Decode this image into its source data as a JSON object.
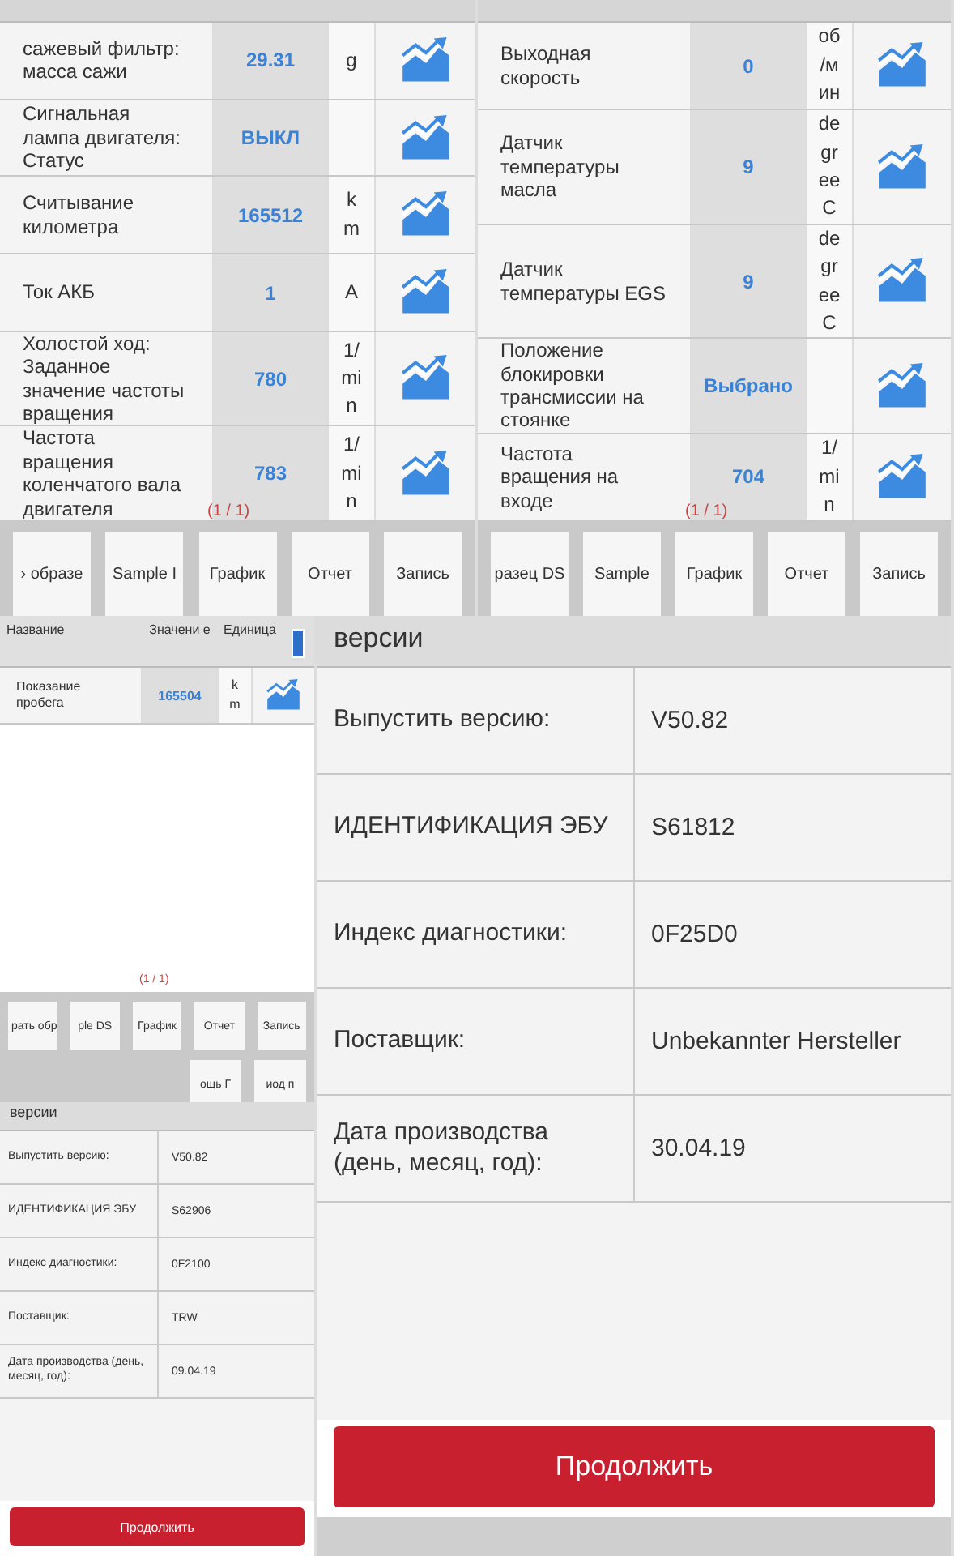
{
  "screens": [
    {
      "kind": "params",
      "page": "(1 / 1)",
      "rows": [
        {
          "name": "сажевый фильтр: масса сажи",
          "value": "29.31",
          "unit": "g"
        },
        {
          "name": "Сигнальная лампа двигателя: Статус",
          "value": "ВЫКЛ",
          "unit": ""
        },
        {
          "name": "Считывание километра",
          "value": "165512",
          "unit": "k m"
        },
        {
          "name": "Ток АКБ",
          "value": "1",
          "unit": "A"
        },
        {
          "name": "Холостой ход: Заданное значение частоты вращения",
          "value": "780",
          "unit": "1/ mi n"
        },
        {
          "name": "Частота вращения коленчатого вала двигателя",
          "value": "783",
          "unit": "1/ mi n"
        }
      ],
      "button_rows": [
        [
          "› образе",
          "Sample I",
          "График",
          "Отчет",
          "Запись"
        ]
      ]
    },
    {
      "kind": "params",
      "page": "(1 / 1)",
      "rows": [
        {
          "name": "Выходная скорость",
          "value": "0",
          "unit": "об /м ин"
        },
        {
          "name": "Датчик температуры масла",
          "value": "9",
          "unit": "de gr ee C"
        },
        {
          "name": "Датчик температуры EGS",
          "value": "9",
          "unit": "de gr ee C"
        },
        {
          "name": "Положение блокировки трансмиссии на стоянке",
          "value": "Выбрано",
          "unit": ""
        },
        {
          "name": "Частота вращения на входе",
          "value": "704",
          "unit": "1/ mi n"
        }
      ],
      "button_rows": [
        [
          "разец DS",
          "Sample",
          "График",
          "Отчет",
          "Запись"
        ]
      ]
    },
    {
      "kind": "params",
      "page": "(1 / 1)",
      "columns": [
        "Название",
        "Значени е",
        "Единица"
      ],
      "rows": [
        {
          "name": "Показание пробега",
          "value": "165504",
          "unit": "k m"
        }
      ],
      "button_rows": [
        [
          "рать обр",
          "ple DS",
          "График",
          "Отчет",
          "Запись"
        ],
        [
          "ощь Г",
          "иод п"
        ]
      ]
    },
    {
      "kind": "info",
      "header": "версии",
      "rows": [
        {
          "label": "Выпустить версию:",
          "value": "V50.82"
        },
        {
          "label": "ИДЕНТИФИКАЦИЯ ЭБУ",
          "value": "S62906"
        },
        {
          "label": "Индекс диагностики:",
          "value": "0F2100"
        },
        {
          "label": "Поставщик:",
          "value": "TRW"
        },
        {
          "label": "Дата производства (день, месяц, год):",
          "value": "09.04.19"
        }
      ],
      "button": "Продолжить"
    },
    {
      "kind": "info",
      "header": "версии",
      "rows": [
        {
          "label": "Выпустить версию:",
          "value": "V50.82"
        },
        {
          "label": "ИДЕНТИФИКАЦИЯ ЭБУ",
          "value": "S61812"
        },
        {
          "label": "Индекс диагностики:",
          "value": "0F25D0"
        },
        {
          "label": "Поставщик:",
          "value": "Unbekannter Hersteller"
        },
        {
          "label": "Дата производства (день, месяц, год):",
          "value": "30.04.19"
        }
      ],
      "button": "Продолжить"
    }
  ]
}
